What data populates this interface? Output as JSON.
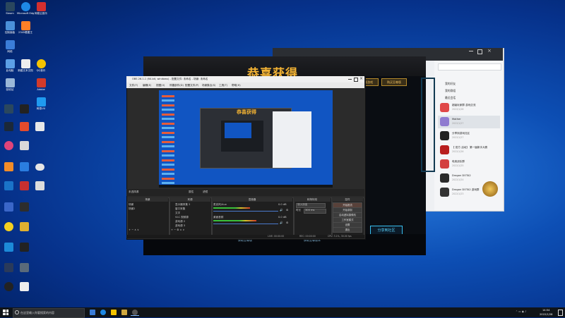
{
  "desktop_icons": [
    {
      "label": "Steam",
      "color": "#2a475e"
    },
    {
      "label": "Microsoft Edge",
      "color": "#1e88e5"
    },
    {
      "label": "网易云音乐",
      "color": "#d32f2f"
    },
    {
      "label": "控制面板",
      "color": "#4a90d9"
    },
    {
      "label": "2345看图王",
      "color": "#ff7f27"
    },
    {
      "label": "网络",
      "color": "#3b7dd8"
    },
    {
      "label": "此电脑",
      "color": "#5ca0e6"
    },
    {
      "label": "新建文本文档",
      "color": "#eeeeee"
    },
    {
      "label": "QQ音乐",
      "color": "#f5c400"
    },
    {
      "label": "回收站",
      "color": "#9bb8d8"
    },
    {
      "label": "Adobe",
      "color": "#d23a2a"
    },
    {
      "label": "网易UU",
      "color": "#1f9af0"
    }
  ],
  "taskbar": {
    "search_placeholder": "在这里输入你要搜索的内容",
    "time": "14:54",
    "date": "2022/1/28"
  },
  "game_window": {
    "title": "恭喜获得",
    "btn_left": "下载游戏",
    "btn_right": "购买至尊版",
    "share_button": "分享到社区",
    "footer_left": "获取至尊版",
    "footer_right": "获取至尊版本"
  },
  "chat_window": {
    "menu": [
      "我的好友",
      "我的群组",
      "最近会话"
    ],
    "items": [
      {
        "name": "超级玩家群 游戏交流",
        "sub": "2022/1/28",
        "color": "#e04848"
      },
      {
        "name": "Mother",
        "sub": "2022/1/27",
        "color": "#8f7bd0"
      },
      {
        "name": "分享到游戏社区",
        "sub": "2022/1/27",
        "color": "#222222"
      },
      {
        "name": "【 官方 活动】 第一届新手大赛",
        "sub": "2022/1/26",
        "color": "#b81e1e"
      },
      {
        "name": "电竞战队群",
        "sub": "2022/1/25",
        "color": "#d34040"
      },
      {
        "name": "Dragon DOTA2",
        "sub": "2022/1/24",
        "color": "#2a2a2a"
      },
      {
        "name": "Dragon DOTA2 游戏群",
        "sub": "2022/1/23",
        "color": "#333333"
      }
    ]
  },
  "obs_window": {
    "title": "OBS 26.1.1 (64-bit, windows) - 配置文件: 未命名 - 场景: 未命名",
    "menu": [
      "文件(F)",
      "编辑(E)",
      "视图(V)",
      "停靠部件(D)",
      "配置文件(P)",
      "场景集合(S)",
      "工具(T)",
      "帮助(H)"
    ],
    "scene_bar_label": "未选择源",
    "scene_bar_btn1": "属性",
    "scene_bar_btn2": "滤镜",
    "panels": {
      "scenes": "场景",
      "sources": "来源",
      "mixer": "混音器",
      "transitions": "转场特效",
      "controls": "控件"
    },
    "scene_items": [
      "场景",
      "场景2"
    ],
    "source_items": [
      "显示器采集 2",
      "窗口采集",
      "文字",
      "VLC 视频源",
      "游戏源 2",
      "游戏源 3"
    ],
    "mixer_items": [
      {
        "name": "麦克风/Aux",
        "db": "0.0 dB",
        "level": 0.55
      },
      {
        "name": "桌面音频",
        "db": "0.0 dB",
        "level": 0.65
      }
    ],
    "transition_value": "淡入淡出",
    "duration_label": "时长",
    "duration_value": "300 ms",
    "controls": [
      "开始推流",
      "开始录制",
      "启动虚拟摄像机",
      "工作室模式",
      "设置",
      "退出"
    ],
    "status": {
      "live": "LIVE: 00:00:00",
      "rec": "REC: 00:00:00",
      "cpu": "CPU: 3.1%, 30.00 fps"
    }
  }
}
